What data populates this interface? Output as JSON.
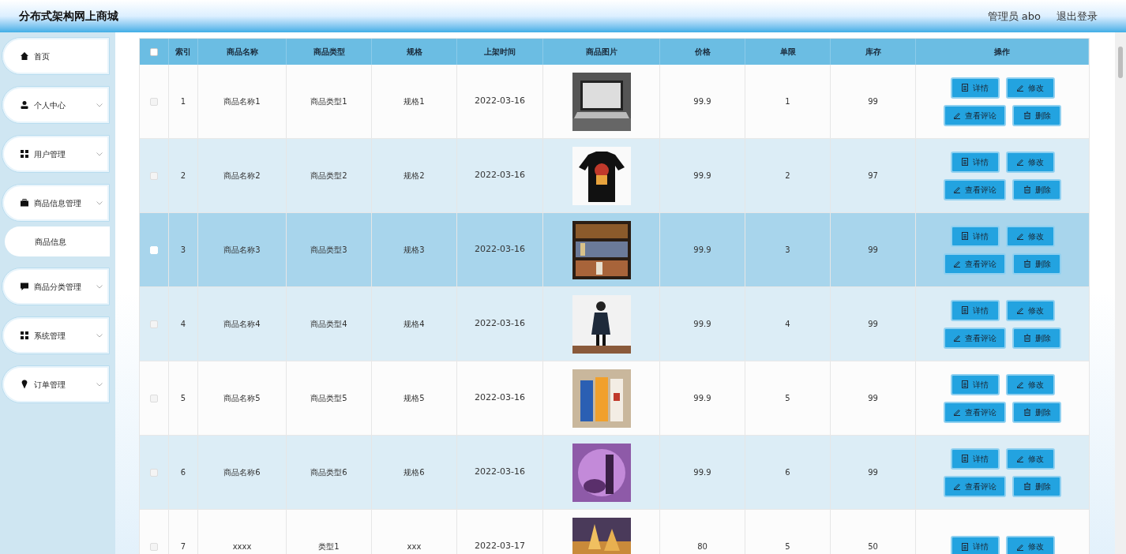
{
  "header": {
    "title": "分布式架构网上商城",
    "user": "管理员 abo",
    "logout": "退出登录"
  },
  "sidebar": {
    "items": [
      {
        "label": "首页",
        "expandable": false
      },
      {
        "label": "个人中心",
        "expandable": true
      },
      {
        "label": "用户管理",
        "expandable": true
      },
      {
        "label": "商品信息管理",
        "expandable": true,
        "children": [
          {
            "label": "商品信息"
          }
        ]
      },
      {
        "label": "商品分类管理",
        "expandable": true
      },
      {
        "label": "系统管理",
        "expandable": true
      },
      {
        "label": "订单管理",
        "expandable": true
      }
    ]
  },
  "table": {
    "select_all": false,
    "columns": [
      "索引",
      "商品名称",
      "商品类型",
      "规格",
      "上架时间",
      "商品图片",
      "价格",
      "单限",
      "库存",
      "操作"
    ],
    "rows": [
      {
        "selected": false,
        "checked": false,
        "cells": [
          "1",
          "商品名称1",
          "商品类型1",
          "规格1",
          "2022-03-16",
          "",
          "99.9",
          "1",
          "99"
        ],
        "actions": [
          "详情",
          "修改",
          "查看评论",
          "删除"
        ]
      },
      {
        "selected": false,
        "checked": false,
        "cells": [
          "2",
          "商品名称2",
          "商品类型2",
          "规格2",
          "2022-03-16",
          "",
          "99.9",
          "2",
          "97"
        ],
        "actions": [
          "详情",
          "修改",
          "查看评论",
          "删除"
        ]
      },
      {
        "selected": true,
        "checked": false,
        "cells": [
          "3",
          "商品名称3",
          "商品类型3",
          "规格3",
          "2022-03-16",
          "",
          "99.9",
          "3",
          "99"
        ],
        "actions": [
          "详情",
          "修改",
          "查看评论",
          "删除"
        ]
      },
      {
        "selected": false,
        "checked": false,
        "cells": [
          "4",
          "商品名称4",
          "商品类型4",
          "规格4",
          "2022-03-16",
          "",
          "99.9",
          "4",
          "99"
        ],
        "actions": [
          "详情",
          "修改",
          "查看评论",
          "删除"
        ]
      },
      {
        "selected": false,
        "checked": false,
        "cells": [
          "5",
          "商品名称5",
          "商品类型5",
          "规格5",
          "2022-03-16",
          "",
          "99.9",
          "5",
          "99"
        ],
        "actions": [
          "详情",
          "修改",
          "查看评论",
          "删除"
        ]
      },
      {
        "selected": false,
        "checked": false,
        "cells": [
          "6",
          "商品名称6",
          "商品类型6",
          "规格6",
          "2022-03-16",
          "",
          "99.9",
          "6",
          "99"
        ],
        "actions": [
          "详情",
          "修改",
          "查看评论",
          "删除"
        ]
      },
      {
        "selected": false,
        "checked": false,
        "cells": [
          "7",
          "xxxx",
          "类型1",
          "xxx",
          "2022-03-17",
          "",
          "80",
          "5",
          "50"
        ],
        "actions": [
          "详情",
          "修改"
        ]
      }
    ]
  }
}
